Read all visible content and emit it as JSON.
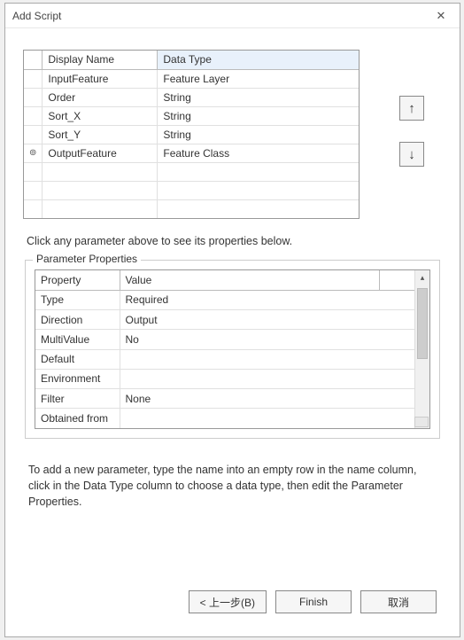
{
  "window": {
    "title": "Add Script",
    "close_icon": "✕"
  },
  "params_table": {
    "headers": {
      "name": "Display Name",
      "type": "Data Type"
    },
    "rows": [
      {
        "marker": "",
        "name": "InputFeature",
        "type": "Feature Layer"
      },
      {
        "marker": "",
        "name": "Order",
        "type": "String"
      },
      {
        "marker": "",
        "name": "Sort_X",
        "type": "String"
      },
      {
        "marker": "",
        "name": "Sort_Y",
        "type": "String"
      },
      {
        "marker": "⊚",
        "name": "OutputFeature",
        "type": "Feature Class"
      }
    ]
  },
  "arrows": {
    "up": "↑",
    "down": "↓"
  },
  "hint": "Click any parameter above to see its properties below.",
  "properties": {
    "legend": "Parameter Properties",
    "headers": {
      "k": "Property",
      "v": "Value"
    },
    "rows": [
      {
        "k": "Type",
        "v": "Required"
      },
      {
        "k": "Direction",
        "v": "Output"
      },
      {
        "k": "MultiValue",
        "v": "No"
      },
      {
        "k": "Default",
        "v": ""
      },
      {
        "k": "Environment",
        "v": ""
      },
      {
        "k": "Filter",
        "v": "None"
      },
      {
        "k": "Obtained from",
        "v": ""
      }
    ]
  },
  "instructions": "To add a new parameter, type the name into an empty row in the name column, click in the Data Type column to choose a data type, then edit the Parameter Properties.",
  "buttons": {
    "back": "< 上一步(B)",
    "finish": "Finish",
    "cancel": "取消"
  }
}
